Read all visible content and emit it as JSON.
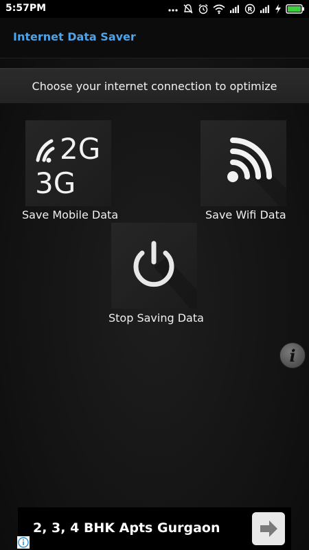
{
  "status_bar": {
    "time": "5:57PM",
    "icons": [
      "more-dots-icon",
      "mute-icon",
      "alarm-icon",
      "wifi-icon",
      "signal-icon",
      "r-badge-icon",
      "signal-icon",
      "charging-icon",
      "battery-icon"
    ]
  },
  "app_bar": {
    "title": "Internet Data Saver",
    "title_color": "#4fa3e6"
  },
  "banner": {
    "text": "Choose your internet connection to optimize"
  },
  "options": {
    "mobile": {
      "label": "Save Mobile Data",
      "icon_text_top": "2G",
      "icon_text_bottom": "3G"
    },
    "wifi": {
      "label": "Save Wifi Data"
    },
    "stop": {
      "label": "Stop Saving Data"
    }
  },
  "info_button": {
    "glyph": "i"
  },
  "ad": {
    "text": "2, 3, 4 BHK Apts Gurgaon"
  }
}
